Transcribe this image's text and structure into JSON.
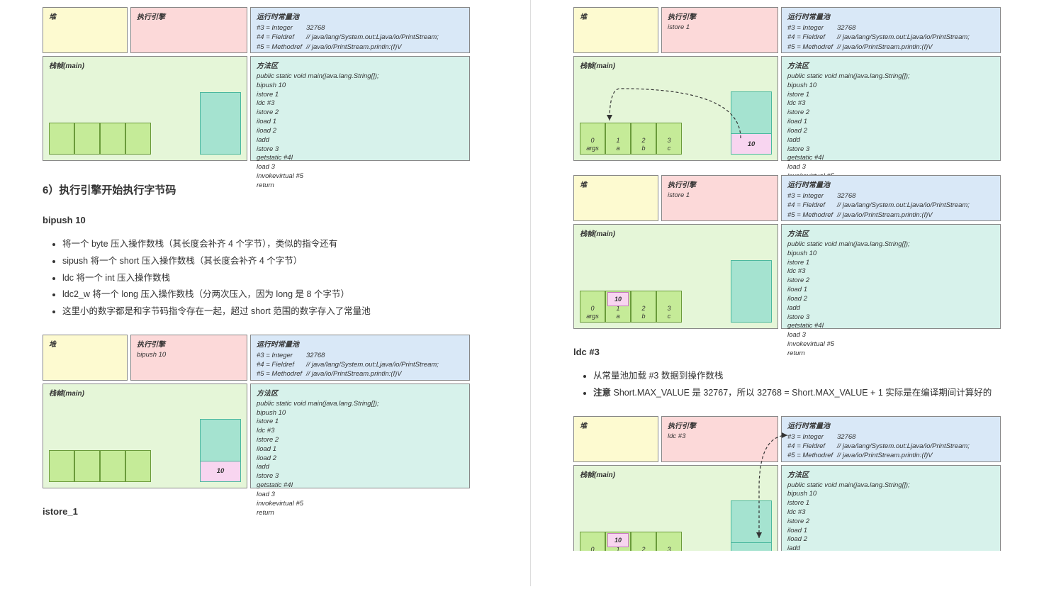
{
  "labels": {
    "heap": "堆",
    "engine": "执行引擎",
    "pool": "运行时常量池",
    "frame": "栈帧(main)",
    "method": "方法区"
  },
  "pool": {
    "r1_k": "#3 = Integer",
    "r1_v": "32768",
    "r2_k": "#4 = Fieldref",
    "r2_v": "// java/lang/System.out:Ljava/io/PrintStream;",
    "r3_k": "#5 = Methodref",
    "r3_v": "// java/io/PrintStream.println:(I)V"
  },
  "method_code": "public static void main(java.lang.String[]);\nbipush 10\nistore 1\nldc #3\nistore 2\niload 1\niload 2\niadd\nistore 3\ngetstatic #4I\nload 3\ninvokevirtual #5\nreturn",
  "headings": {
    "h1": "6）执行引擎开始执行字节码",
    "bipush": "bipush 10",
    "istore": "istore_1",
    "ldc": "ldc #3"
  },
  "bullets_bipush": {
    "b1": "将一个 byte 压入操作数栈（其长度会补齐 4 个字节），类似的指令还有",
    "b2": "sipush 将一个 short 压入操作数栈（其长度会补齐 4 个字节）",
    "b3": "ldc 将一个 int 压入操作数栈",
    "b4": "ldc2_w 将一个 long 压入操作数栈（分两次压入，因为 long 是 8 个字节）",
    "b5": "这里小的数字都是和字节码指令存在一起，超过 short 范围的数字存入了常量池"
  },
  "bullets_ldc": {
    "b1": "从常量池加载 #3 数据到操作数栈",
    "b2": "注意 Short.MAX_VALUE 是 32767，所以 32768 = Short.MAX_VALUE + 1 实际是在编译期间计算好的"
  },
  "engine_text": {
    "bipush": "bipush 10",
    "istore": "istore 1",
    "ldc": "ldc #3"
  },
  "slot_labels": {
    "s0a": "0",
    "s0b": "args",
    "s1a": "1",
    "s1b": "a",
    "s2a": "2",
    "s2b": "b",
    "s3a": "3",
    "s3b": "c"
  },
  "values": {
    "ten": "10"
  },
  "bold": {
    "note": "注意"
  }
}
